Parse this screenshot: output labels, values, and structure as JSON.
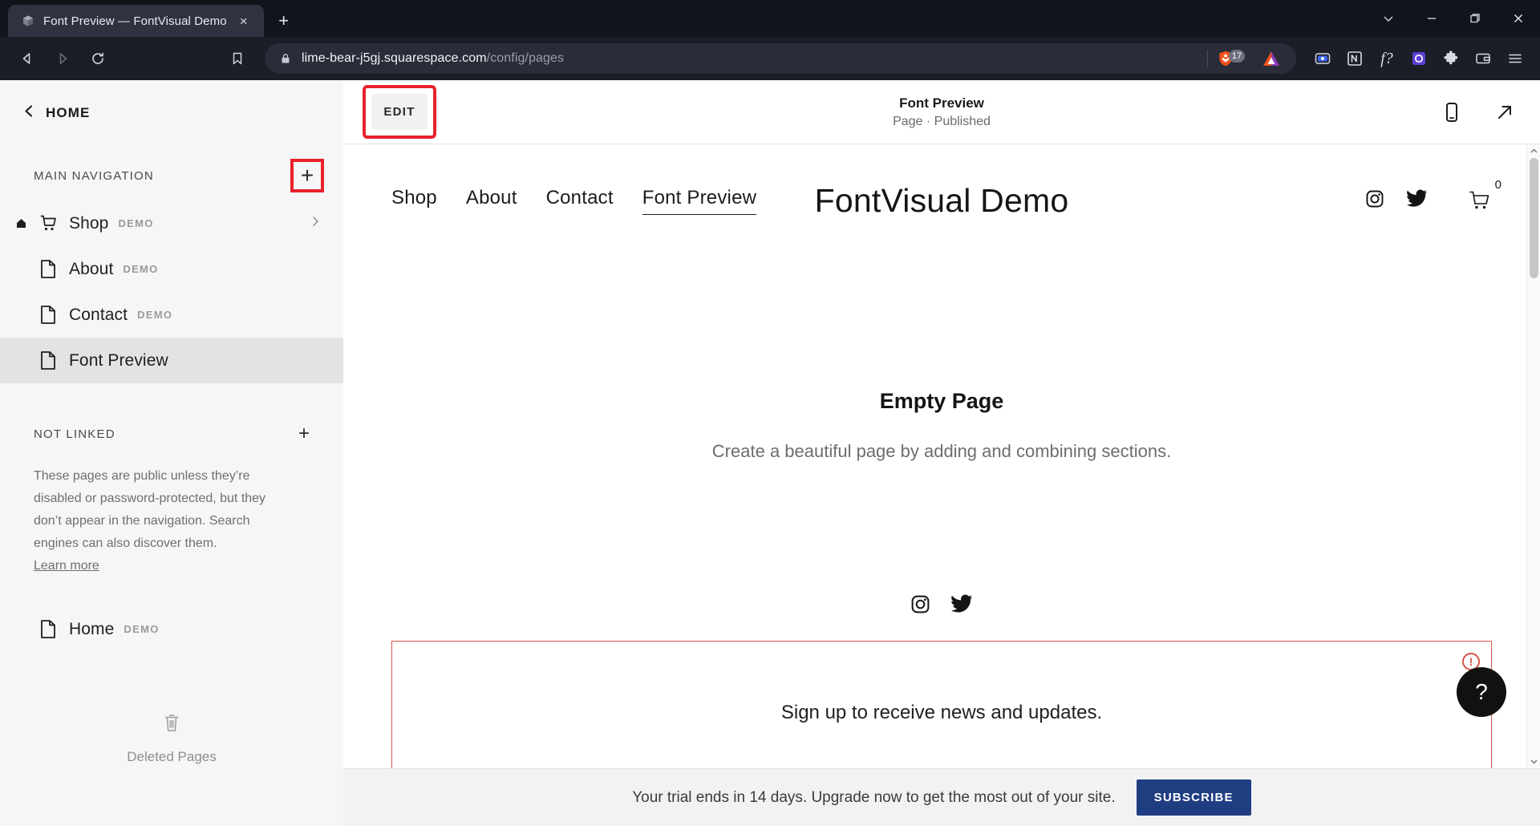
{
  "browser": {
    "tab": {
      "title": "Font Preview — FontVisual Demo",
      "favicon": "cube-icon",
      "close": "×"
    },
    "newtab_label": "+",
    "window_controls": {
      "minimize_group": "⌄",
      "minimize": "—",
      "restore": "❐",
      "close": "✕"
    },
    "nav": {
      "back": "back-icon",
      "forward": "forward-icon",
      "reload": "reload-icon",
      "bookmark": "bookmark-icon"
    },
    "omnibox": {
      "lock": "lock-icon",
      "url_host": "lime-bear-j5gj.squarespace.com",
      "url_path": "/config/pages",
      "shield_badge": "17"
    },
    "toolbar_icons": [
      "brave-shield-icon",
      "bat-triangle-icon",
      "capture-icon",
      "notion-icon",
      "f-question-icon",
      "opera-o-icon",
      "extensions-puzzle-icon",
      "wallet-icon",
      "hamburger-menu-icon"
    ]
  },
  "sidebar": {
    "home_label": "HOME",
    "main_navigation": {
      "title": "MAIN NAVIGATION",
      "add_label": "+",
      "items": [
        {
          "label": "Shop",
          "badge": "DEMO",
          "icon": "cart-icon",
          "homepage": true,
          "chevron": "›",
          "active": false
        },
        {
          "label": "About",
          "badge": "DEMO",
          "icon": "page-icon",
          "homepage": false,
          "chevron": "",
          "active": false
        },
        {
          "label": "Contact",
          "badge": "DEMO",
          "icon": "page-icon",
          "homepage": false,
          "chevron": "",
          "active": false
        },
        {
          "label": "Font Preview",
          "badge": "",
          "icon": "page-icon",
          "homepage": false,
          "chevron": "",
          "active": true
        }
      ]
    },
    "not_linked": {
      "title": "NOT LINKED",
      "add_label": "+",
      "description": "These pages are public unless they’re disabled or password-protected, but they don’t appear in the navigation. Search engines can also discover them.",
      "learn_more": "Learn more",
      "items": [
        {
          "label": "Home",
          "badge": "DEMO",
          "icon": "page-icon"
        }
      ]
    },
    "deleted_pages": {
      "label": "Deleted Pages",
      "icon": "trash-icon"
    }
  },
  "preview_header": {
    "edit_label": "EDIT",
    "page_title": "Font Preview",
    "page_status": "Page · Published",
    "mobile_icon": "mobile-device-icon",
    "open_icon": "external-link-icon"
  },
  "site": {
    "nav_items": [
      {
        "label": "Shop",
        "current": false
      },
      {
        "label": "About",
        "current": false
      },
      {
        "label": "Contact",
        "current": false
      },
      {
        "label": "Font Preview",
        "current": true
      }
    ],
    "brand": "FontVisual Demo",
    "social": [
      "instagram-icon",
      "twitter-icon"
    ],
    "cart": {
      "icon": "shopping-cart-icon",
      "count": "0"
    },
    "empty_state": {
      "title": "Empty Page",
      "subtitle": "Create a beautiful page by adding and combining sections."
    },
    "footer_social": [
      "instagram-icon",
      "twitter-icon"
    ],
    "newsletter": {
      "text": "Sign up to receive news and updates.",
      "alert": "!",
      "border_color": "#d4564a"
    }
  },
  "help": {
    "label": "?"
  },
  "trial_bar": {
    "message": "Your trial ends in 14 days. Upgrade now to get the most out of your site.",
    "subscribe_label": "SUBSCRIBE",
    "accent": "#1f3e82"
  },
  "highlight_color": "#e8212d"
}
